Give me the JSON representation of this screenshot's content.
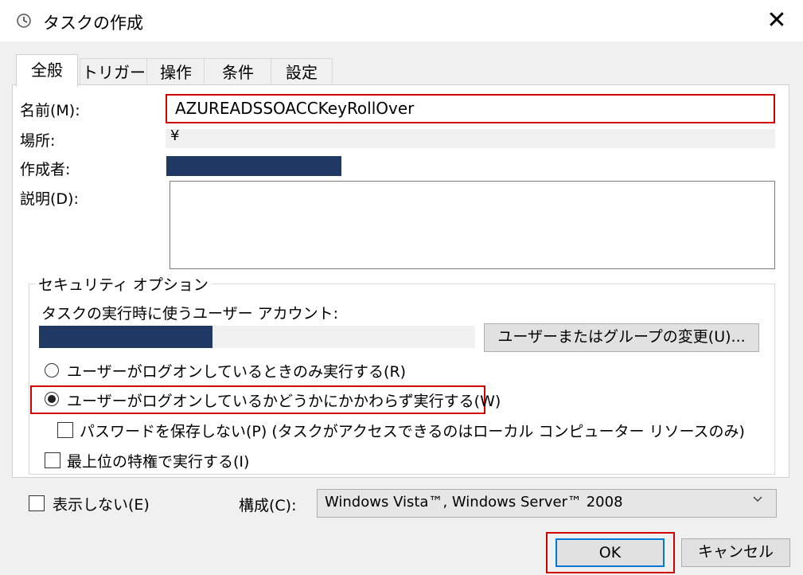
{
  "window": {
    "title": "タスクの作成",
    "close_glyph": "✕"
  },
  "tabs": [
    {
      "label": "全般",
      "active": true
    },
    {
      "label": "トリガー",
      "active": false
    },
    {
      "label": "操作",
      "active": false
    },
    {
      "label": "条件",
      "active": false
    },
    {
      "label": "設定",
      "active": false
    }
  ],
  "general": {
    "name_label": "名前(M):",
    "name_value": "AZUREADSSOACCKeyRollOver",
    "location_label": "場所:",
    "location_value": "¥",
    "author_label": "作成者:",
    "description_label": "説明(D):"
  },
  "security": {
    "legend": "セキュリティ オプション",
    "run_as_label": "タスクの実行時に使うユーザー アカウント:",
    "change_button": "ユーザーまたはグループの変更(U)...",
    "radio_logged_on": "ユーザーがログオンしているときのみ実行する(R)",
    "radio_whether": "ユーザーがログオンしているかどうかにかかわらず実行する(W)",
    "selected_radio": "radio_whether",
    "no_password": "パスワードを保存しない(P) (タスクがアクセスできるのはローカル コンピューター リソースのみ)",
    "highest_privileges": "最上位の特権で実行する(I)"
  },
  "footer": {
    "hidden_label": "表示しない(E)",
    "config_label": "構成(C):",
    "config_value": "Windows Vista™, Windows Server™ 2008",
    "ok": "OK",
    "cancel": "キャンセル"
  },
  "colors": {
    "highlight": "#d00000",
    "redaction": "#1f3864",
    "accent": "#0078d7"
  }
}
